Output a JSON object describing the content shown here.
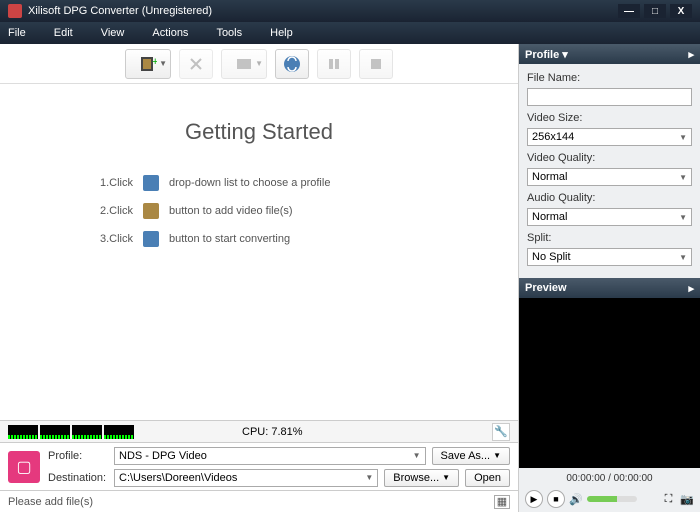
{
  "title": "Xilisoft DPG Converter (Unregistered)",
  "menu": [
    "File",
    "Edit",
    "View",
    "Actions",
    "Tools",
    "Help"
  ],
  "gs": {
    "heading": "Getting Started",
    "steps": [
      {
        "n": "1.Click",
        "txt": "drop-down list to choose a profile"
      },
      {
        "n": "2.Click",
        "txt": "button to add video file(s)"
      },
      {
        "n": "3.Click",
        "txt": "button to start converting"
      }
    ]
  },
  "cpu": {
    "label": "CPU: 7.81%"
  },
  "profile": {
    "profile_label": "Profile:",
    "profile_value": "NDS - DPG Video",
    "dest_label": "Destination:",
    "dest_value": "C:\\Users\\Doreen\\Videos",
    "saveas": "Save As...",
    "browse": "Browse...",
    "open": "Open"
  },
  "status": {
    "msg": "Please add file(s)"
  },
  "right": {
    "profile_hdr": "Profile",
    "file_name": "File Name:",
    "video_size": "Video Size:",
    "video_size_val": "256x144",
    "video_quality": "Video Quality:",
    "video_quality_val": "Normal",
    "audio_quality": "Audio Quality:",
    "audio_quality_val": "Normal",
    "split": "Split:",
    "split_val": "No Split",
    "preview_hdr": "Preview",
    "time": "00:00:00 / 00:00:00"
  }
}
